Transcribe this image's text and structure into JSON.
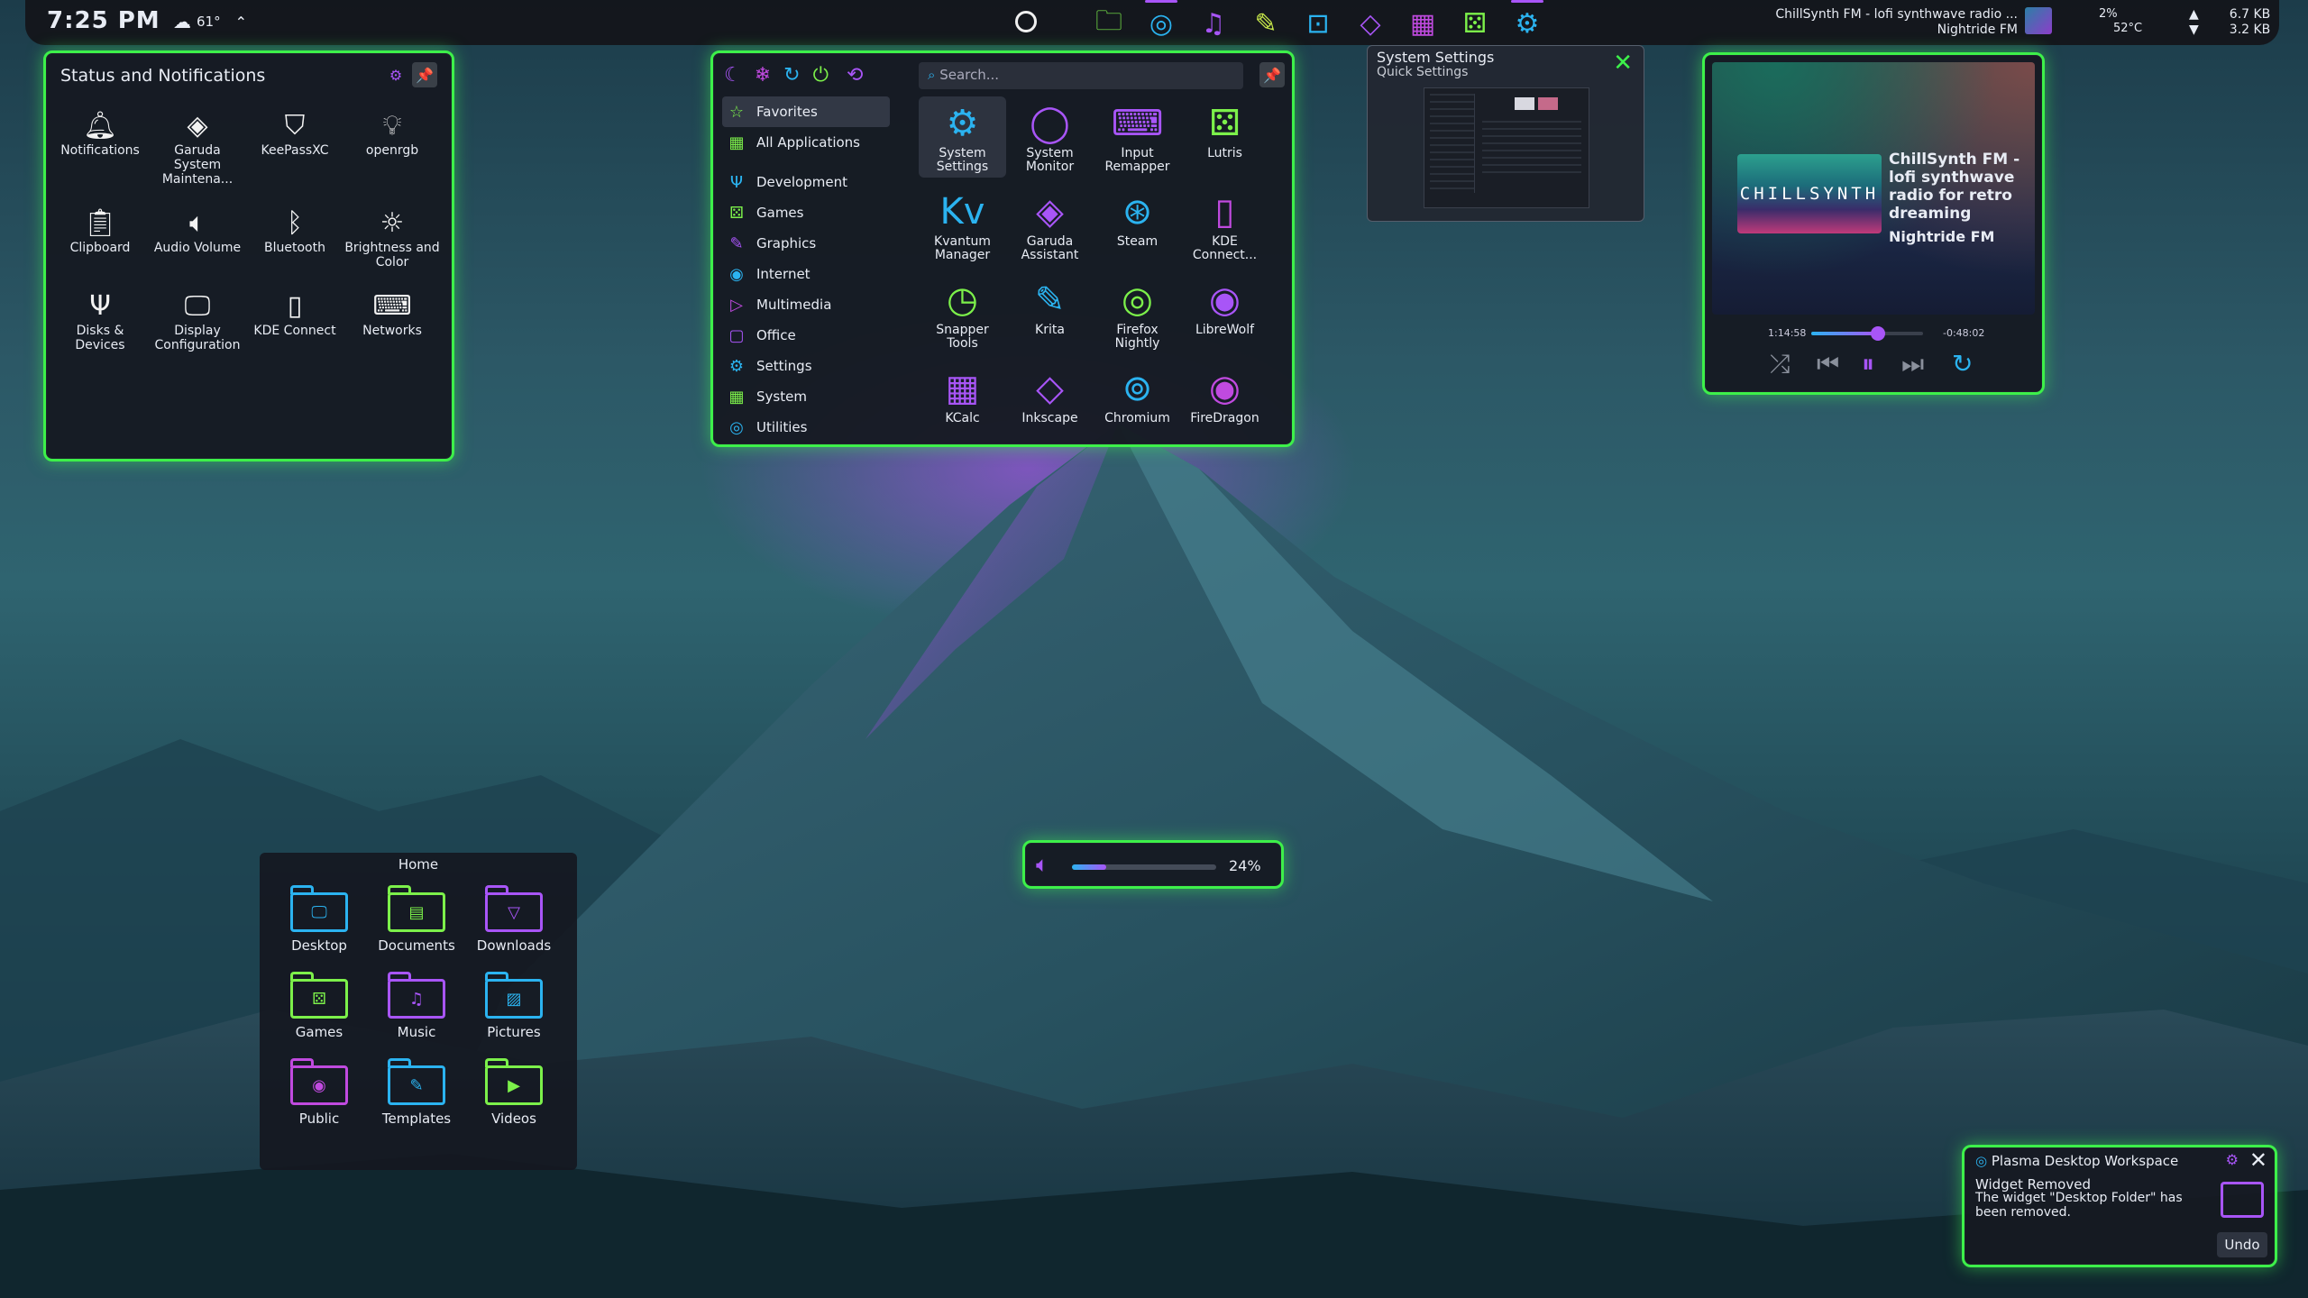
{
  "colors": {
    "accent_green": "#3df04a",
    "accent_purple": "#a855f7",
    "accent_cyan": "#2bb3f0",
    "accent_lime": "#7cf04a"
  },
  "topbar": {
    "clock": "7:25 PM",
    "temperature": "61°",
    "task_icons": [
      "folder-icon",
      "firefox-icon",
      "music-icon",
      "notes-icon",
      "terminal-icon",
      "kdeconnect-icon",
      "kcalc-icon",
      "games-icon",
      "gear-icon"
    ],
    "now_playing_title": "ChillSynth FM - lofi synthwave radio ...",
    "now_playing_artist": "Nightride FM",
    "cpu": "2%",
    "cpu_temp": "52°C",
    "net_up": "6.7 KB",
    "net_down": "3.2 KB"
  },
  "status": {
    "title": "Status and Notifications",
    "items": [
      {
        "label": "Notifications",
        "icon": "bell-icon"
      },
      {
        "label": "Garuda System Maintena...",
        "icon": "garuda-icon"
      },
      {
        "label": "KeePassXC",
        "icon": "shield-icon"
      },
      {
        "label": "openrgb",
        "icon": "bulb-icon"
      },
      {
        "label": "Clipboard",
        "icon": "clipboard-icon"
      },
      {
        "label": "Audio Volume",
        "icon": "speaker-icon"
      },
      {
        "label": "Bluetooth",
        "icon": "bluetooth-icon"
      },
      {
        "label": "Brightness and Color",
        "icon": "sun-icon"
      },
      {
        "label": "Disks & Devices",
        "icon": "usb-icon"
      },
      {
        "label": "Display Configuration",
        "icon": "monitor-icon"
      },
      {
        "label": "KDE Connect",
        "icon": "phone-icon"
      },
      {
        "label": "Networks",
        "icon": "network-icon"
      }
    ]
  },
  "launcher": {
    "search_placeholder": "Search...",
    "categories": [
      "Favorites",
      "All Applications",
      "Development",
      "Games",
      "Graphics",
      "Internet",
      "Multimedia",
      "Office",
      "Settings",
      "System",
      "Utilities"
    ],
    "apps": [
      {
        "label": "System Settings"
      },
      {
        "label": "System Monitor"
      },
      {
        "label": "Input Remapper"
      },
      {
        "label": "Lutris"
      },
      {
        "label": "Kvantum Manager"
      },
      {
        "label": "Garuda Assistant"
      },
      {
        "label": "Steam"
      },
      {
        "label": "KDE Connect..."
      },
      {
        "label": "Snapper Tools"
      },
      {
        "label": "Krita"
      },
      {
        "label": "Firefox Nightly"
      },
      {
        "label": "LibreWolf"
      },
      {
        "label": "KCalc"
      },
      {
        "label": "Inkscape"
      },
      {
        "label": "Chromium"
      },
      {
        "label": "FireDragon"
      }
    ]
  },
  "preview": {
    "title": "System Settings",
    "subtitle": "Quick Settings"
  },
  "media": {
    "cover_text": "CHILLSYNTH",
    "title": "ChillSynth FM - lofi synthwave radio for retro dreaming",
    "artist": "Nightride FM",
    "elapsed": "1:14:58",
    "remaining": "-0:48:02",
    "progress": 0.6
  },
  "volume": {
    "percent_label": "24%",
    "level": 0.24
  },
  "home": {
    "title": "Home",
    "folders": [
      "Desktop",
      "Documents",
      "Downloads",
      "Games",
      "Music",
      "Pictures",
      "Public",
      "Templates",
      "Videos"
    ]
  },
  "notification": {
    "app": "Plasma Desktop Workspace",
    "heading": "Widget Removed",
    "body": "The widget \"Desktop Folder\" has been removed.",
    "action": "Undo"
  }
}
